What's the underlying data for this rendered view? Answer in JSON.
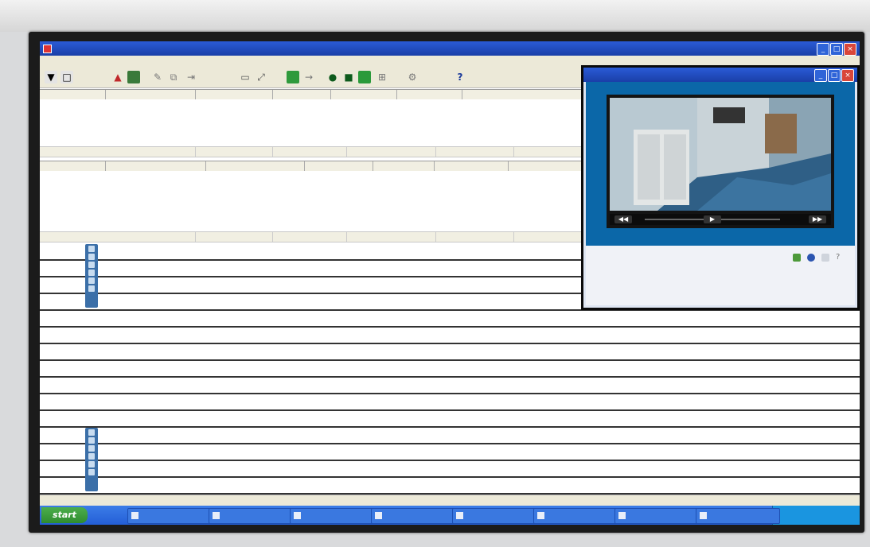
{
  "app": {
    "title": ""
  },
  "menu": [],
  "toolbar": {
    "help_label": "?"
  },
  "grid_top": {
    "headers": [],
    "footer": []
  },
  "grid_bottom": {
    "headers": [],
    "footer": []
  },
  "log_rows": [
    {
      "time": "",
      "message": "",
      "thumb": true
    },
    {
      "time": "",
      "message": "",
      "thumb": true
    },
    {
      "time": "",
      "message": "",
      "thumb": true
    },
    {
      "time": "",
      "message": "",
      "thumb": true
    },
    {
      "time": "",
      "message": "",
      "thumb": false
    },
    {
      "time": "",
      "message": "",
      "thumb": false
    },
    {
      "time": "",
      "message": "",
      "thumb": false
    },
    {
      "time": "",
      "message": "",
      "thumb": false
    },
    {
      "time": "",
      "message": "",
      "thumb": false
    },
    {
      "time": "",
      "message": "",
      "thumb": false
    },
    {
      "time": "",
      "message": "",
      "thumb": false
    },
    {
      "time": "",
      "message": "",
      "thumb": true
    },
    {
      "time": "",
      "message": "",
      "thumb": true
    },
    {
      "time": "",
      "message": "",
      "thumb": true
    },
    {
      "time": "",
      "message": "",
      "thumb": true
    }
  ],
  "status_bar": {
    "left": "",
    "right": ""
  },
  "taskbar": {
    "start_label": "start",
    "task_count": 8
  },
  "video_window": {
    "title": "",
    "caption": "",
    "footer": ""
  },
  "colors": {
    "title_bar": "#1a3fa8",
    "taskbar": "#245ed6",
    "start_button": "#2f8c2f",
    "video_panel": "#0b67a8",
    "thumb_strip": "#3b6fa8"
  }
}
